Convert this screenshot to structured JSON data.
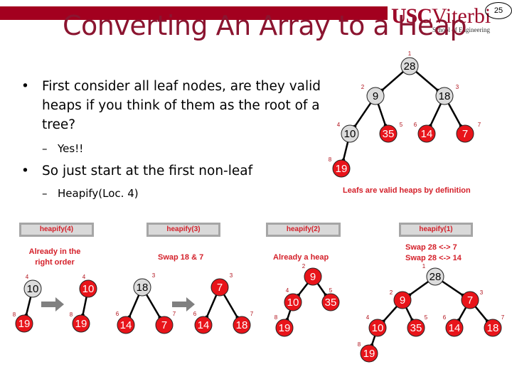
{
  "header": {
    "logo_usc": "USC",
    "logo_viterbi": "Viterbi",
    "logo_subtitle": "School of Engineering",
    "page_number": "25",
    "brand_color": "#a3001f"
  },
  "title": "Converting An Array to a Heap",
  "bullets": [
    {
      "text": "First consider all leaf nodes, are they valid heaps if you think of them as the root of a tree?",
      "sub": "Yes!!"
    },
    {
      "text": "So just start at the first non-leaf",
      "sub": "Heapify(Loc. 4)"
    }
  ],
  "colors": {
    "node_red": "#e8141a",
    "node_gray": "#dcdcdc",
    "label_red": "#b0101a",
    "caption_red": "#d4202a"
  },
  "main_tree": {
    "caption": "Leafs are valid heaps by definition",
    "nodes": [
      {
        "loc": "1",
        "value": "28",
        "state": "gray"
      },
      {
        "loc": "2",
        "value": "9",
        "state": "gray"
      },
      {
        "loc": "3",
        "value": "18",
        "state": "gray"
      },
      {
        "loc": "4",
        "value": "10",
        "state": "gray"
      },
      {
        "loc": "5",
        "value": "35",
        "state": "red"
      },
      {
        "loc": "6",
        "value": "14",
        "state": "red"
      },
      {
        "loc": "7",
        "value": "7",
        "state": "red"
      },
      {
        "loc": "8",
        "value": "19",
        "state": "red"
      }
    ]
  },
  "panels": [
    {
      "label": "heapify(4)",
      "caption": "Already in the right order",
      "before": [
        {
          "loc": "4",
          "value": "10",
          "state": "gray"
        },
        {
          "loc": "8",
          "value": "19",
          "state": "red"
        }
      ],
      "after": [
        {
          "loc": "4",
          "value": "10",
          "state": "red"
        },
        {
          "loc": "8",
          "value": "19",
          "state": "red"
        }
      ]
    },
    {
      "label": "heapify(3)",
      "caption": "Swap 18 & 7",
      "before": [
        {
          "loc": "3",
          "value": "18",
          "state": "gray"
        },
        {
          "loc": "6",
          "value": "14",
          "state": "red"
        },
        {
          "loc": "7",
          "value": "7",
          "state": "red"
        }
      ],
      "after": [
        {
          "loc": "3",
          "value": "7",
          "state": "red"
        },
        {
          "loc": "6",
          "value": "14",
          "state": "red"
        },
        {
          "loc": "7",
          "value": "18",
          "state": "red"
        }
      ]
    },
    {
      "label": "heapify(2)",
      "caption": "Already a heap",
      "nodes": [
        {
          "loc": "2",
          "value": "9",
          "state": "red"
        },
        {
          "loc": "4",
          "value": "10",
          "state": "red"
        },
        {
          "loc": "5",
          "value": "35",
          "state": "red"
        },
        {
          "loc": "8",
          "value": "19",
          "state": "red"
        }
      ]
    },
    {
      "label": "heapify(1)",
      "caption_lines": [
        "Swap 28 <-> 7",
        "Swap 28 <-> 14"
      ],
      "nodes": [
        {
          "loc": "1",
          "value": "28",
          "state": "gray"
        },
        {
          "loc": "2",
          "value": "9",
          "state": "red"
        },
        {
          "loc": "3",
          "value": "7",
          "state": "red"
        },
        {
          "loc": "4",
          "value": "10",
          "state": "red"
        },
        {
          "loc": "5",
          "value": "35",
          "state": "red"
        },
        {
          "loc": "6",
          "value": "14",
          "state": "red"
        },
        {
          "loc": "7",
          "value": "18",
          "state": "red"
        },
        {
          "loc": "8",
          "value": "19",
          "state": "red"
        }
      ]
    }
  ]
}
